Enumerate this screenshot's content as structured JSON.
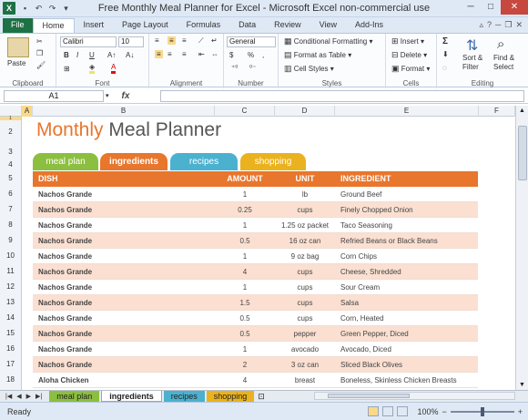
{
  "titlebar": {
    "app_icon": "X",
    "title": "Free Monthly Meal Planner for Excel  -  Microsoft Excel non-commercial use"
  },
  "ribbon_tabs": [
    "File",
    "Home",
    "Insert",
    "Page Layout",
    "Formulas",
    "Data",
    "Review",
    "View",
    "Add-Ins"
  ],
  "ribbon": {
    "clipboard": {
      "paste": "Paste",
      "label": "Clipboard"
    },
    "font": {
      "name": "Calibri",
      "size": "10",
      "bold": "B",
      "italic": "I",
      "underline": "U",
      "label": "Font"
    },
    "alignment": {
      "label": "Alignment"
    },
    "number": {
      "format": "General",
      "currency": "$",
      "percent": "%",
      "comma": ",",
      "label": "Number"
    },
    "styles": {
      "conditional": "Conditional Formatting",
      "table": "Format as Table",
      "cell": "Cell Styles",
      "label": "Styles"
    },
    "cells": {
      "insert": "Insert",
      "delete": "Delete",
      "format": "Format",
      "label": "Cells"
    },
    "editing": {
      "sum": "Σ",
      "sort": "Sort &",
      "sort2": "Filter",
      "find": "Find &",
      "find2": "Select",
      "label": "Editing"
    }
  },
  "formula_bar": {
    "cell_ref": "A1",
    "fx": "fx",
    "value": ""
  },
  "columns": [
    "A",
    "B",
    "C",
    "D",
    "E",
    "F"
  ],
  "rows": [
    "1",
    "2",
    "3",
    "4",
    "5",
    "6",
    "7",
    "8",
    "9",
    "10",
    "11",
    "12",
    "13",
    "14",
    "15",
    "16",
    "17",
    "18"
  ],
  "planner": {
    "title_part1": "Monthly",
    "title_part2": "Meal Planner",
    "tabs": [
      {
        "label": "meal plan",
        "color": "#8cbf3f"
      },
      {
        "label": "ingredients",
        "color": "#e8762d"
      },
      {
        "label": "recipes",
        "color": "#4bb1cf"
      },
      {
        "label": "shopping",
        "color": "#eab21e"
      }
    ],
    "headers": {
      "dish": "DISH",
      "amount": "AMOUNT",
      "unit": "UNIT",
      "ingredient": "INGREDIENT"
    },
    "rows": [
      {
        "dish": "Nachos Grande",
        "amount": "1",
        "unit": "lb",
        "ingredient": "Ground Beef"
      },
      {
        "dish": "Nachos Grande",
        "amount": "0.25",
        "unit": "cups",
        "ingredient": "Finely Chopped Onion"
      },
      {
        "dish": "Nachos Grande",
        "amount": "1",
        "unit": "1.25 oz packet",
        "ingredient": "Taco Seasoning"
      },
      {
        "dish": "Nachos Grande",
        "amount": "0.5",
        "unit": "16 oz can",
        "ingredient": "Refried Beans or Black Beans"
      },
      {
        "dish": "Nachos Grande",
        "amount": "1",
        "unit": "9 oz bag",
        "ingredient": "Corn Chips"
      },
      {
        "dish": "Nachos Grande",
        "amount": "4",
        "unit": "cups",
        "ingredient": "Cheese, Shredded"
      },
      {
        "dish": "Nachos Grande",
        "amount": "1",
        "unit": "cups",
        "ingredient": "Sour Cream"
      },
      {
        "dish": "Nachos Grande",
        "amount": "1.5",
        "unit": "cups",
        "ingredient": "Salsa"
      },
      {
        "dish": "Nachos Grande",
        "amount": "0.5",
        "unit": "cups",
        "ingredient": "Corn, Heated"
      },
      {
        "dish": "Nachos Grande",
        "amount": "0.5",
        "unit": "pepper",
        "ingredient": "Green Pepper, Diced"
      },
      {
        "dish": "Nachos Grande",
        "amount": "1",
        "unit": "avocado",
        "ingredient": "Avocado, Diced"
      },
      {
        "dish": "Nachos Grande",
        "amount": "2",
        "unit": "3 oz can",
        "ingredient": "Sliced Black Olives"
      },
      {
        "dish": "Aloha Chicken",
        "amount": "4",
        "unit": "breast",
        "ingredient": "Boneless, Skinless Chicken Breasts"
      }
    ]
  },
  "sheet_tabs": [
    {
      "label": "meal plan",
      "color": "#8cbf3f"
    },
    {
      "label": "ingredients",
      "color": "#ffffff"
    },
    {
      "label": "recipes",
      "color": "#4bb1cf"
    },
    {
      "label": "shopping",
      "color": "#eab21e"
    }
  ],
  "status": {
    "ready": "Ready",
    "zoom": "100%",
    "minus": "−",
    "plus": "+"
  }
}
